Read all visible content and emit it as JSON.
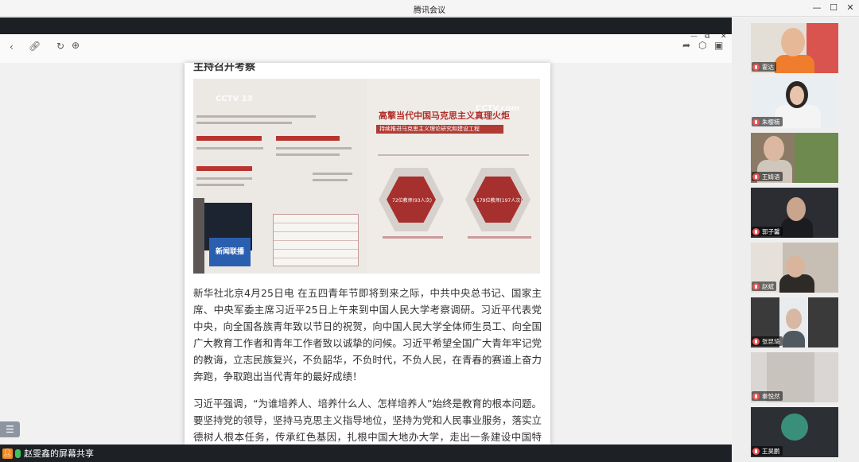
{
  "window": {
    "title": "腾讯会议"
  },
  "browser_icons": [
    "back-icon",
    "link-icon",
    "refresh-icon",
    "globe-icon",
    "share-icon",
    "cube-icon",
    "layout-icon"
  ],
  "article": {
    "cut_heading": "主持召开考察",
    "photo": {
      "right_title": "高擎当代中国马克思主义真理火炬",
      "right_subtitle": "持续推进马克思主义理论研究和建设工程",
      "logo_top_left": "CCTV 13",
      "logo_top_right": "CCTV.com",
      "tv_label": "新闻联播",
      "hex1": "72位教师(93人次)",
      "hex2": "179位教师(197人次)"
    },
    "paragraphs": [
      "新华社北京4月25日电 在五四青年节即将到来之际，中共中央总书记、国家主席、中央军委主席习近平25日上午来到中国人民大学考察调研。习近平代表党中央，向全国各族青年致以节日的祝贺，向中国人民大学全体师生员工、向全国广大教育工作者和青年工作者致以诚挚的问候。习近平希望全国广大青年牢记党的教诲，立志民族复兴，不负韶华，不负时代，不负人民，在青春的赛道上奋力奔跑，争取跑出当代青年的最好成绩！",
      "习近平强调，“为谁培养人、培养什么人、怎样培养人”始终是教育的根本问题。要坚持党的领导，坚持马克思主义指导地位，坚持为党和人民事业服务，落实立德树人根本任务，传承红色基因，扎根中国大地办大学，走出一条建设中国特色、"
    ]
  },
  "participants": [
    {
      "name": "霍达"
    },
    {
      "name": "朱樱楠"
    },
    {
      "name": "王婧语"
    },
    {
      "name": "郭子馨"
    },
    {
      "name": "赵斌"
    },
    {
      "name": "张昆琦"
    },
    {
      "name": "秦悦然"
    },
    {
      "name": "王昊鹏"
    }
  ],
  "status": {
    "sharing_label": "赵雯鑫的屏幕共享"
  },
  "colors": {
    "accent_red": "#b2302c",
    "mic_green": "#3cc35a",
    "share_orange": "#f08a24"
  }
}
